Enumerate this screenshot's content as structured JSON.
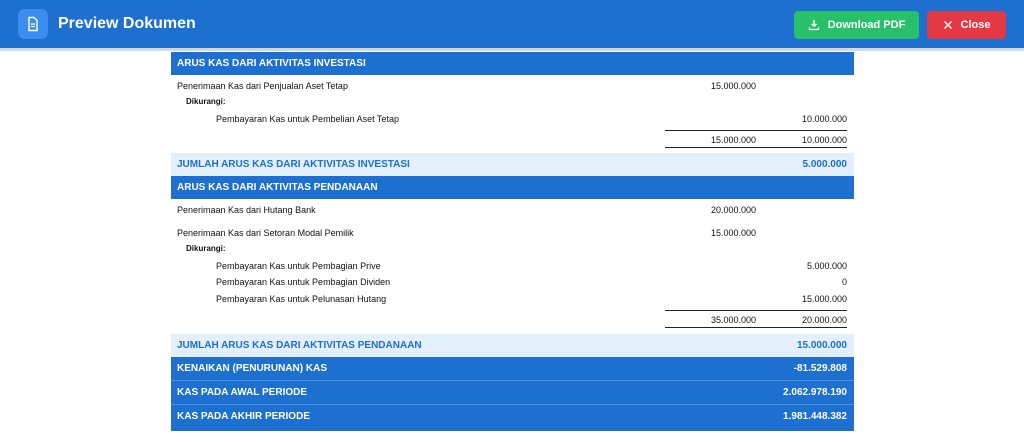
{
  "header": {
    "title": "Preview Dokumen",
    "download_label": "Download PDF",
    "close_label": "Close"
  },
  "colors": {
    "header": "#1d6fd0",
    "download": "#28c06a",
    "close": "#e53845",
    "section_band": "#1d6fd0",
    "total_band": "#e3f0fc"
  },
  "investasi": {
    "heading": "ARUS KAS DARI AKTIVITAS INVESTASI",
    "row1_label": "Penerimaan Kas dari Penjualan Aset Tetap",
    "row1_c1": "15.000.000",
    "dikurangi": "Dikurangi:",
    "row2_label": "Pembayaran Kas untuk Pembelian Aset Tetap",
    "row2_c2": "10.000.000",
    "sub_c1": "15.000.000",
    "sub_c2": "10.000.000",
    "total_label": "JUMLAH ARUS KAS DARI AKTIVITAS INVESTASI",
    "total_value": "5.000.000"
  },
  "pendanaan": {
    "heading": "ARUS KAS DARI AKTIVITAS PENDANAAN",
    "row1_label": "Penerimaan Kas dari Hutang Bank",
    "row1_c1": "20.000.000",
    "row2_label": "Penerimaan Kas dari Setoran Modal Pemilik",
    "row2_c1": "15.000.000",
    "dikurangi": "Dikurangi:",
    "row3_label": "Pembayaran Kas untuk Pembagian Prive",
    "row3_c2": "5.000.000",
    "row4_label": "Pembayaran Kas untuk Pembagian Dividen",
    "row4_c2": "0",
    "row5_label": "Pembayaran Kas untuk Pelunasan Hutang",
    "row5_c2": "15.000.000",
    "sub_c1": "35.000.000",
    "sub_c2": "20.000.000",
    "total_label": "JUMLAH ARUS KAS DARI AKTIVITAS PENDANAAN",
    "total_value": "15.000.000"
  },
  "summary": {
    "kenaikan_label": "KENAIKAN (PENURUNAN) KAS",
    "kenaikan_value": "-81.529.808",
    "awal_label": "KAS PADA AWAL PERIODE",
    "awal_value": "2.062.978.190",
    "akhir_label": "KAS PADA AKHIR PERIODE",
    "akhir_value": "1.981.448.382"
  }
}
